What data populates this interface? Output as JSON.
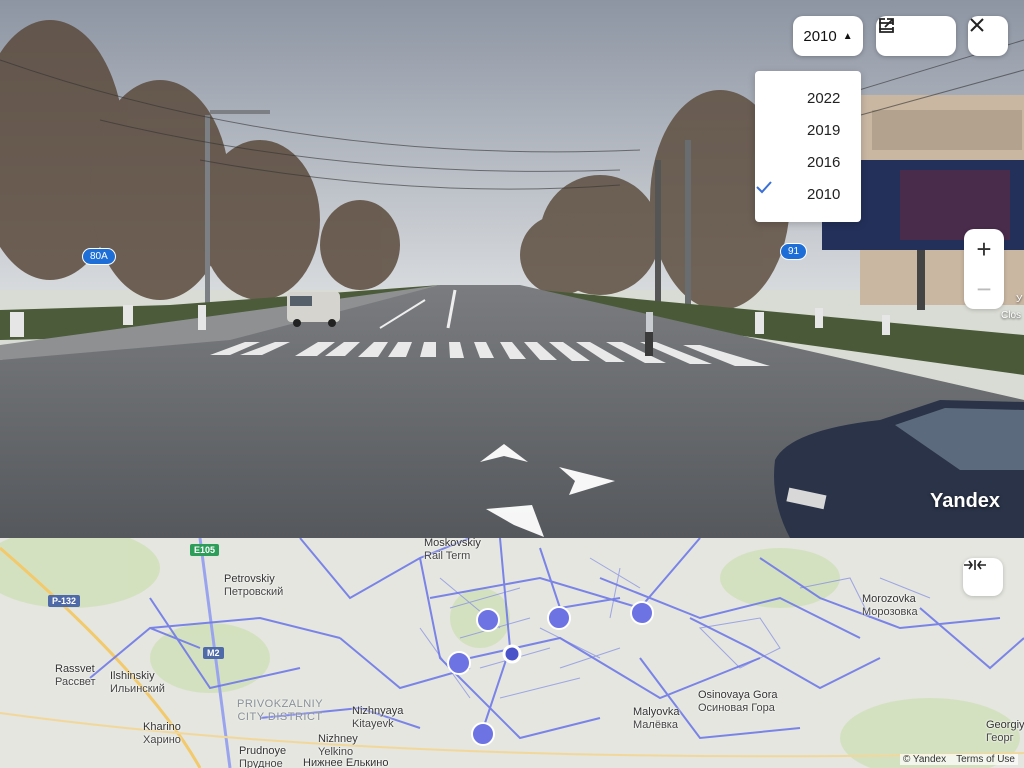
{
  "panorama": {
    "year_button": {
      "label": "2010",
      "caret": "▲"
    },
    "year_menu": [
      {
        "label": "2022",
        "selected": false
      },
      {
        "label": "2019",
        "selected": false
      },
      {
        "label": "2016",
        "selected": false
      },
      {
        "label": "2010",
        "selected": true
      }
    ],
    "zoom": {
      "in": "+",
      "out": "−"
    },
    "logo": "Yandex",
    "signs": {
      "route_left": "80A",
      "route_right": "91"
    },
    "edge_text": {
      "line1": "У",
      "line2": "Clos"
    },
    "icons": [
      "external-link-icon",
      "menu-icon",
      "close-icon",
      "check-icon",
      "nav-arrow-icon"
    ]
  },
  "map": {
    "roads": {
      "e105": "E105",
      "p132": "P-132",
      "m2": "M2"
    },
    "labels": [
      {
        "name": "Petrovskiy",
        "sub": "Петровский"
      },
      {
        "name": "Moskovskiy",
        "sub": "Rail Term"
      },
      {
        "name": "Rassvet",
        "sub": "Рассвет"
      },
      {
        "name": "Ilshinskiy",
        "sub": "Ильинский"
      },
      {
        "name": "Kharino",
        "sub": "Харино"
      },
      {
        "name": "Prudnoye",
        "sub": "Прудное"
      },
      {
        "name": "Nizhnyaya",
        "sub": "Kitayevk"
      },
      {
        "name": "Nizhney",
        "sub": "Yelkino"
      },
      {
        "name": "Malyovka",
        "sub": "Малёвка"
      },
      {
        "name": "Osinovaya Gora",
        "sub": "Осиновая Гора"
      },
      {
        "name": "Morozovka",
        "sub": "Морозовка"
      },
      {
        "name": "Georgiy",
        "sub": "Георг"
      }
    ],
    "district": {
      "line1": "PRIVOKZALNIY",
      "line2": "CITY DISTRICT"
    },
    "extra_label": "Нижнее Елькино",
    "footer": {
      "copyright": "© Yandex",
      "terms": "Terms of Use"
    },
    "colors": {
      "routes": "#6f79e8",
      "pin": "#6d73e3"
    }
  }
}
